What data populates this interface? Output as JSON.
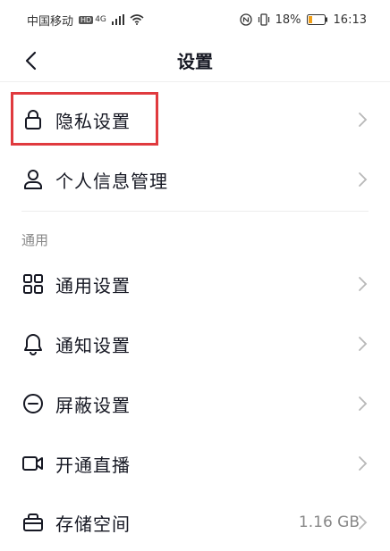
{
  "status_bar": {
    "carrier": "中国移动",
    "signal_badge": "HD",
    "network": "4G",
    "battery_percent": "18%",
    "time": "16:13"
  },
  "header": {
    "title": "设置"
  },
  "rows": [
    {
      "label": "隐私设置",
      "icon": "lock-icon"
    },
    {
      "label": "个人信息管理",
      "icon": "person-icon"
    },
    {
      "label": "通用设置",
      "icon": "grid-icon"
    },
    {
      "label": "通知设置",
      "icon": "bell-icon"
    },
    {
      "label": "屏蔽设置",
      "icon": "block-icon"
    },
    {
      "label": "开通直播",
      "icon": "video-icon"
    },
    {
      "label": "存储空间",
      "icon": "storage-icon",
      "value": "1.16 GB"
    }
  ],
  "section_general": {
    "title": "通用"
  },
  "colors": {
    "highlight": "#e03a3e",
    "text": "#161823",
    "secondary": "#888888"
  }
}
